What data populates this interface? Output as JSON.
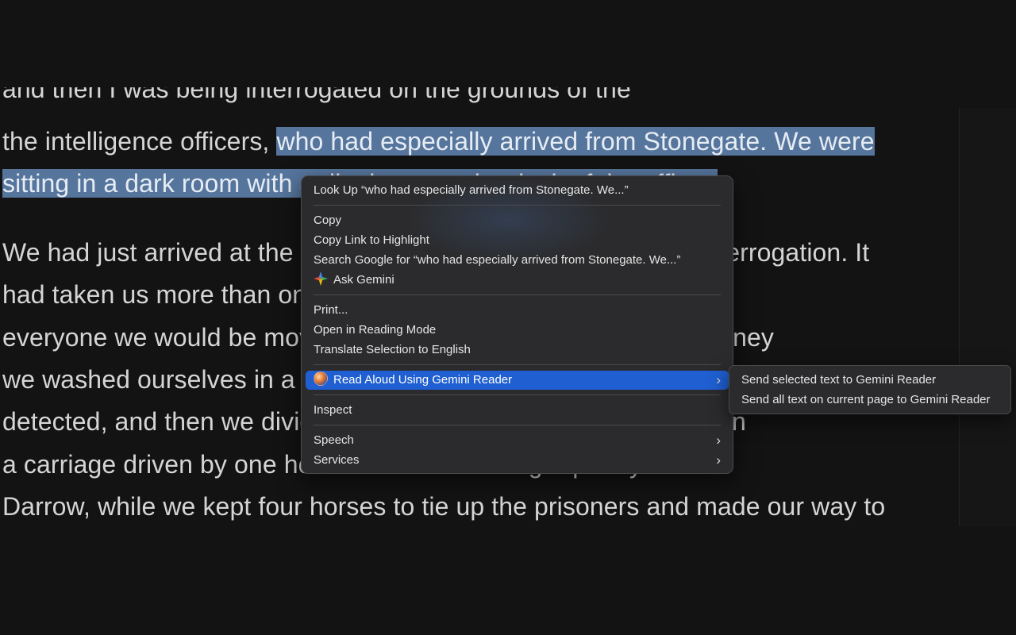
{
  "document": {
    "partial_top_line": "and then I was being interrogated on the grounds of the",
    "line1_plain": "the intelligence officers, ",
    "line1_selected": "who had especially arrived from Stonegate. We were",
    "line2_selected": "sitting in a dark room with a dim lamp on the desk of the officer.",
    "paragraph2_lines": [
      "We had just arrived at the camp and were about to begin this interrogation. It",
      "had taken us more than one week to get here, and while I told",
      "everyone we would be moving slowly, on the third day of the journey",
      "we washed ourselves in a river so as not to be detected, and then we divided; the privates were given",
      "detected, and then we divided the horses; the privates were given",
      "a carriage driven by one horse and ordered to go quickly to Fort",
      "Darrow, while we kept four horses to tie up the prisoners and made our way to"
    ]
  },
  "context_menu": {
    "look_up": "Look Up “who had especially arrived from Stonegate. We...”",
    "copy": "Copy",
    "copy_link": "Copy Link to Highlight",
    "search_google": "Search Google for “who had especially arrived from Stonegate. We...”",
    "ask_gemini": "Ask Gemini",
    "print": "Print...",
    "reading_mode": "Open in Reading Mode",
    "translate": "Translate Selection to English",
    "read_aloud": "Read Aloud Using Gemini Reader",
    "inspect": "Inspect",
    "speech": "Speech",
    "services": "Services",
    "chevron": "›"
  },
  "submenu": {
    "send_selected": "Send selected text to Gemini Reader",
    "send_all": "Send all text on current page to Gemini Reader"
  },
  "colors": {
    "selection": "#56759d",
    "menu_bg": "#2b2b2d",
    "active_item": "#1f5fd1"
  }
}
